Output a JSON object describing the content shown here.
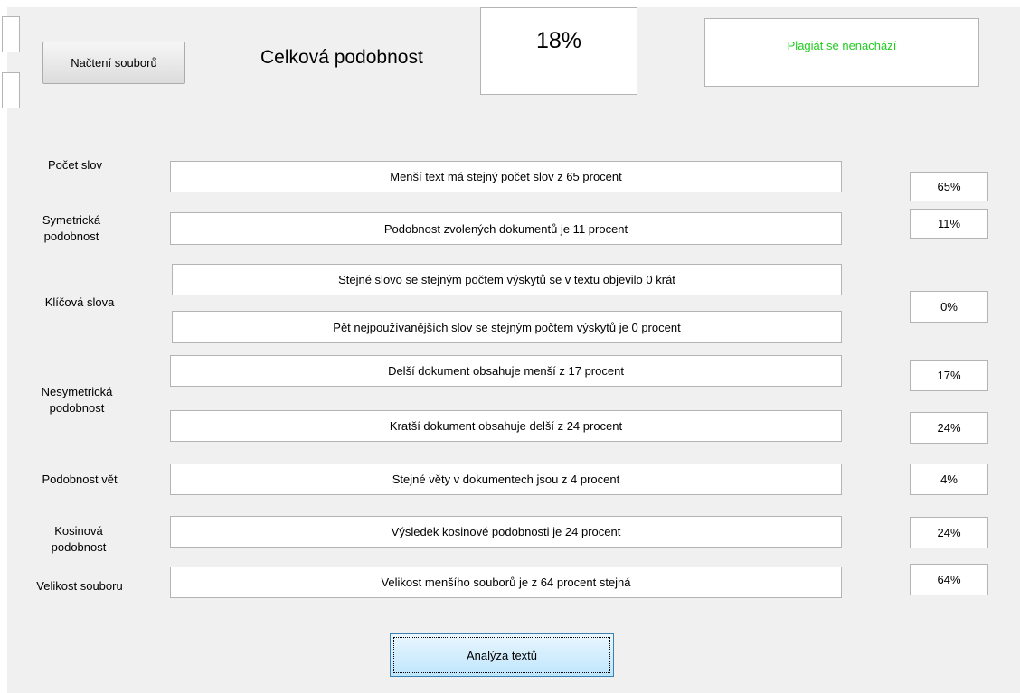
{
  "header": {
    "load_button_label": "Načtení souborů",
    "total_similarity_label": "Celková podobnost",
    "total_similarity_value": "18%",
    "plagiarism_status": "Plagiát se nenachází",
    "status_color": "#22cc22"
  },
  "metrics": {
    "word_count": {
      "label": "Počet slov",
      "description": "Menší text má stejný počet slov z 65 procent",
      "value": "65%"
    },
    "symmetric": {
      "label": "Symetrická podobnost",
      "description": "Podobnost zvolených dokumentů je 11 procent",
      "value": "11%"
    },
    "keywords": {
      "label": "Klíčová slova",
      "description_1": "Stejné slovo se stejným počtem výskytů se v textu objevilo 0 krát",
      "description_2": "Pět nejpoužívanějších slov se stejným počtem výskytů je 0 procent",
      "value": "0%"
    },
    "asymmetric": {
      "label": "Nesymetrická podobnost",
      "description_1": "Delší dokument obsahuje menší z 17 procent",
      "value_1": "17%",
      "description_2": "Kratší dokument obsahuje delší z 24 procent",
      "value_2": "24%"
    },
    "sentences": {
      "label": "Podobnost vět",
      "description": "Stejné věty v dokumentech jsou z 4 procent",
      "value": "4%"
    },
    "cosine": {
      "label": "Kosinová podobnost",
      "description": "Výsledek kosinové podobnosti je 24 procent",
      "value": "24%"
    },
    "file_size": {
      "label": "Velikost souboru",
      "description": "Velikost menšího souborů je z 64 procent stejná",
      "value": "64%"
    }
  },
  "footer": {
    "analyze_button_label": "Analýza textů"
  }
}
